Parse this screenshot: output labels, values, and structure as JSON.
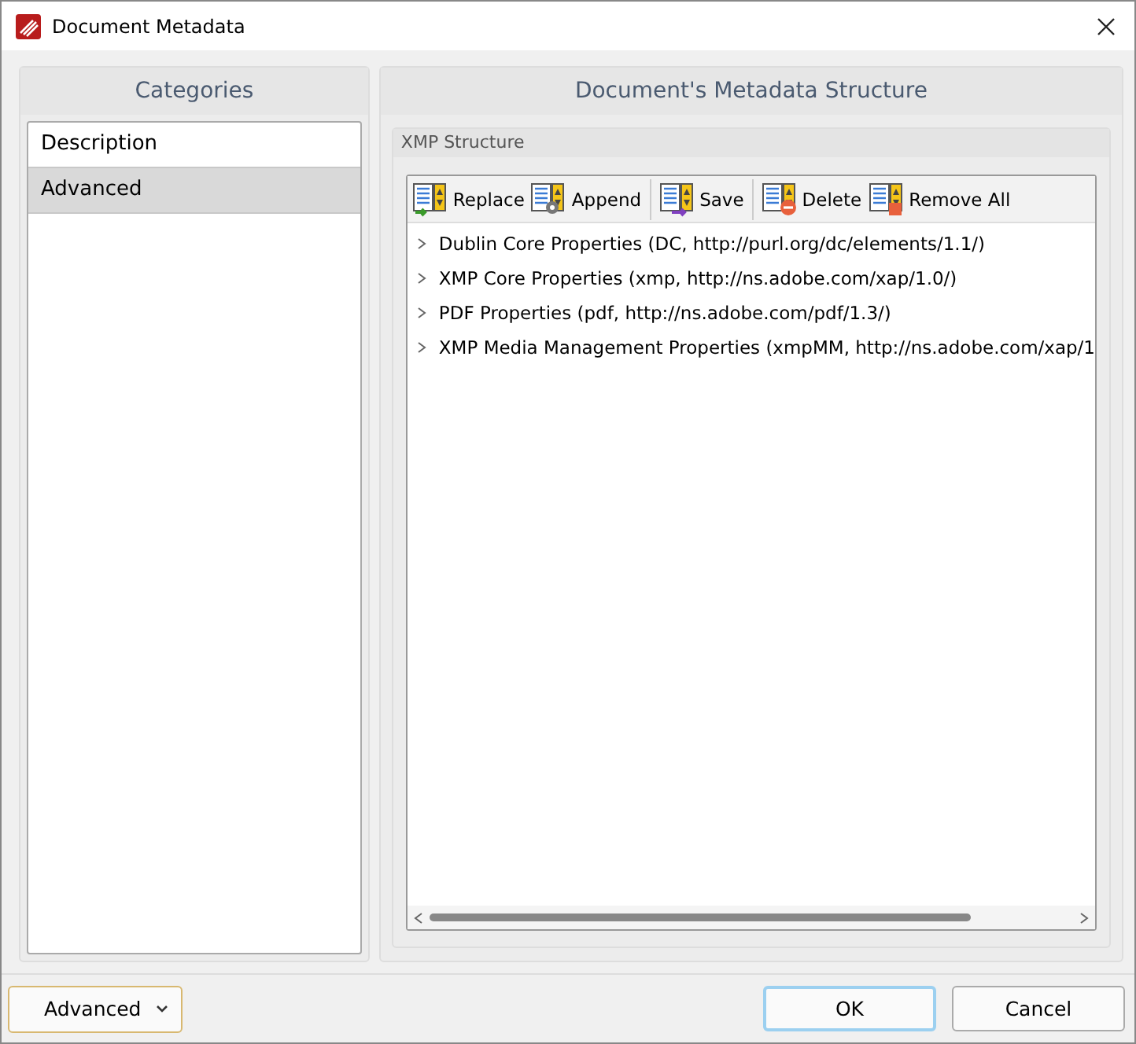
{
  "window": {
    "title": "Document Metadata"
  },
  "categories": {
    "title": "Categories",
    "items": [
      {
        "label": "Description",
        "selected": false
      },
      {
        "label": "Advanced",
        "selected": true
      }
    ]
  },
  "structure": {
    "title": "Document's Metadata Structure",
    "group_title": "XMP Structure",
    "toolbar_groups": [
      [
        {
          "kind": "replace",
          "label": "Replace"
        },
        {
          "kind": "append",
          "label": "Append"
        }
      ],
      [
        {
          "kind": "save",
          "label": "Save"
        }
      ],
      [
        {
          "kind": "delete",
          "label": "Delete"
        },
        {
          "kind": "remove_all",
          "label": "Remove All"
        }
      ]
    ],
    "tree": [
      {
        "label": "Dublin Core Properties (DC, http://purl.org/dc/elements/1.1/)",
        "expanded": false
      },
      {
        "label": "XMP Core Properties (xmp, http://ns.adobe.com/xap/1.0/)",
        "expanded": false
      },
      {
        "label": "PDF Properties (pdf, http://ns.adobe.com/pdf/1.3/)",
        "expanded": false
      },
      {
        "label": "XMP Media Management Properties (xmpMM, http://ns.adobe.com/xap/1",
        "expanded": false
      }
    ]
  },
  "footer": {
    "mode": "Advanced",
    "buttons": [
      {
        "label": "OK",
        "default": true
      },
      {
        "label": "Cancel",
        "default": false
      }
    ]
  }
}
